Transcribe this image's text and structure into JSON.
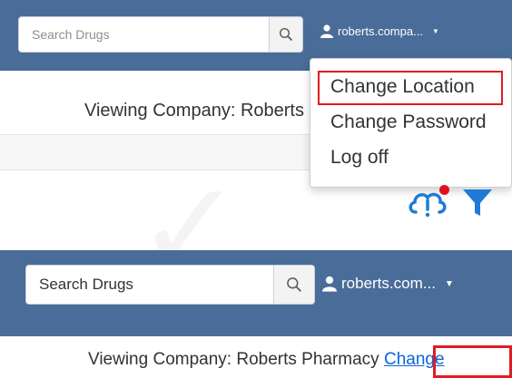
{
  "top_view": {
    "search": {
      "placeholder": "Search Drugs"
    },
    "user_menu": {
      "username": "roberts.compa..."
    },
    "dropdown": {
      "items": [
        {
          "label": "Change Location"
        },
        {
          "label": "Change Password"
        },
        {
          "label": "Log off"
        }
      ]
    },
    "viewing_company": "Viewing Company: Roberts Pharmacy"
  },
  "bottom_view": {
    "search": {
      "placeholder": "Search Drugs"
    },
    "user_menu": {
      "username": "roberts.com..."
    },
    "viewing_company_prefix": "Viewing Company: Roberts Pharmacy ",
    "change_link": "Change"
  },
  "colors": {
    "navbar": "#4a6c98",
    "highlight": "#e01b24",
    "link": "#0b66d6",
    "filter_icon": "#1e7ad6",
    "notification_dot": "#e0111c"
  },
  "icons": [
    "search-icon",
    "user-icon",
    "caret-down-icon",
    "cloud-alert-icon",
    "filter-icon"
  ]
}
